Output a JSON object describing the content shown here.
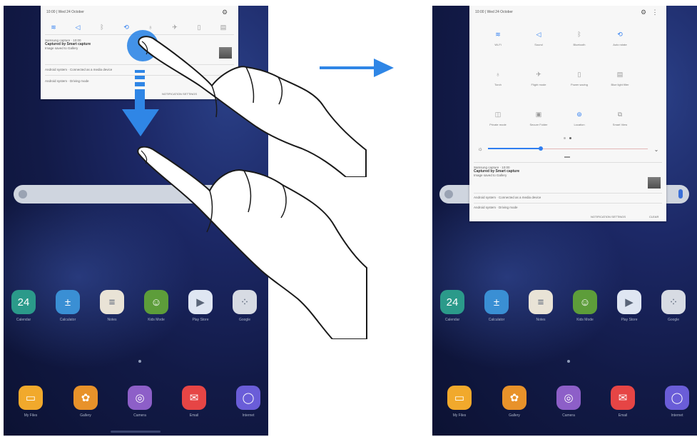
{
  "colors": {
    "accent": "#2f7ef0",
    "wallpaper": "#121a47",
    "panel": "#f7f7f7",
    "arrow": "#2f86e6"
  },
  "left_panel": {
    "status_time": "10:00 | Wed 24 October",
    "toggles": [
      "wifi-icon",
      "sound-icon",
      "bluetooth-icon",
      "auto-rotate-icon",
      "flashlight-icon",
      "airplane-icon",
      "battery-icon",
      "mobile-data-icon"
    ],
    "notif1_app": "Samsung capture · 10:00",
    "notif1_title": "Captured by Smart capture",
    "notif1_text": "Image saved to Gallery",
    "notif2": "Android system · Connected as a media device",
    "notif3": "Android system · Driving mode",
    "footer": "NOTIFICATION SETTINGS"
  },
  "right_panel": {
    "status_time": "10:00 | Wed 24 October",
    "tiles": [
      {
        "icon": "wifi-icon",
        "label": "Wi-Fi",
        "on": true
      },
      {
        "icon": "sound-icon",
        "label": "Sound",
        "on": true
      },
      {
        "icon": "bluetooth-icon",
        "label": "Bluetooth",
        "on": false
      },
      {
        "icon": "auto-rotate-icon",
        "label": "Auto rotate",
        "on": true
      },
      {
        "icon": "flashlight-icon",
        "label": "Torch",
        "on": false
      },
      {
        "icon": "airplane-icon",
        "label": "Flight mode",
        "on": false
      },
      {
        "icon": "power-saving-icon",
        "label": "Power saving",
        "on": false
      },
      {
        "icon": "blue-light-icon",
        "label": "Blue light filter",
        "on": false
      },
      {
        "icon": "private-mode-icon",
        "label": "Private mode",
        "on": false
      },
      {
        "icon": "secure-folder-icon",
        "label": "Secure Folder",
        "on": false
      },
      {
        "icon": "location-icon",
        "label": "Location",
        "on": true
      },
      {
        "icon": "smart-view-icon",
        "label": "Smart View",
        "on": false
      }
    ],
    "brightness": 0.33,
    "notif1_app": "Samsung capture · 10:00",
    "notif1_title": "Captured by Smart capture",
    "notif1_text": "Image saved to Gallery",
    "notif2": "Android system · Connected as a media device",
    "notif3": "Android system · Driving mode",
    "footer_settings": "NOTIFICATION SETTINGS",
    "footer_clear": "CLEAR"
  },
  "apps_row1": [
    {
      "label": "Calendar",
      "icon": "calendar-icon",
      "glyph": "24",
      "color": "#2b9a8a"
    },
    {
      "label": "Calculator",
      "icon": "calculator-icon",
      "glyph": "±",
      "color": "#3a8fd4"
    },
    {
      "label": "Notes",
      "icon": "notes-icon",
      "glyph": "≡",
      "color": "#e9e3d6"
    },
    {
      "label": "Kids Mode",
      "icon": "kids-mode-icon",
      "glyph": "☺",
      "color": "#5d9d3a"
    },
    {
      "label": "Play Store",
      "icon": "play-store-icon",
      "glyph": "▶",
      "color": "#dfe6f2"
    },
    {
      "label": "Google",
      "icon": "google-folder-icon",
      "glyph": "⁘",
      "color": "#d7dbe3"
    }
  ],
  "apps_row2": [
    {
      "label": "My Files",
      "icon": "my-files-icon",
      "glyph": "▭",
      "color": "#f1a92c"
    },
    {
      "label": "Gallery",
      "icon": "gallery-icon",
      "glyph": "✿",
      "color": "#e8922a"
    },
    {
      "label": "Camera",
      "icon": "camera-icon",
      "glyph": "◎",
      "color": "#8d5fc8"
    },
    {
      "label": "Email",
      "icon": "email-icon",
      "glyph": "✉",
      "color": "#e64545"
    },
    {
      "label": "Internet",
      "icon": "internet-icon",
      "glyph": "◯",
      "color": "#6a5dd8"
    }
  ]
}
